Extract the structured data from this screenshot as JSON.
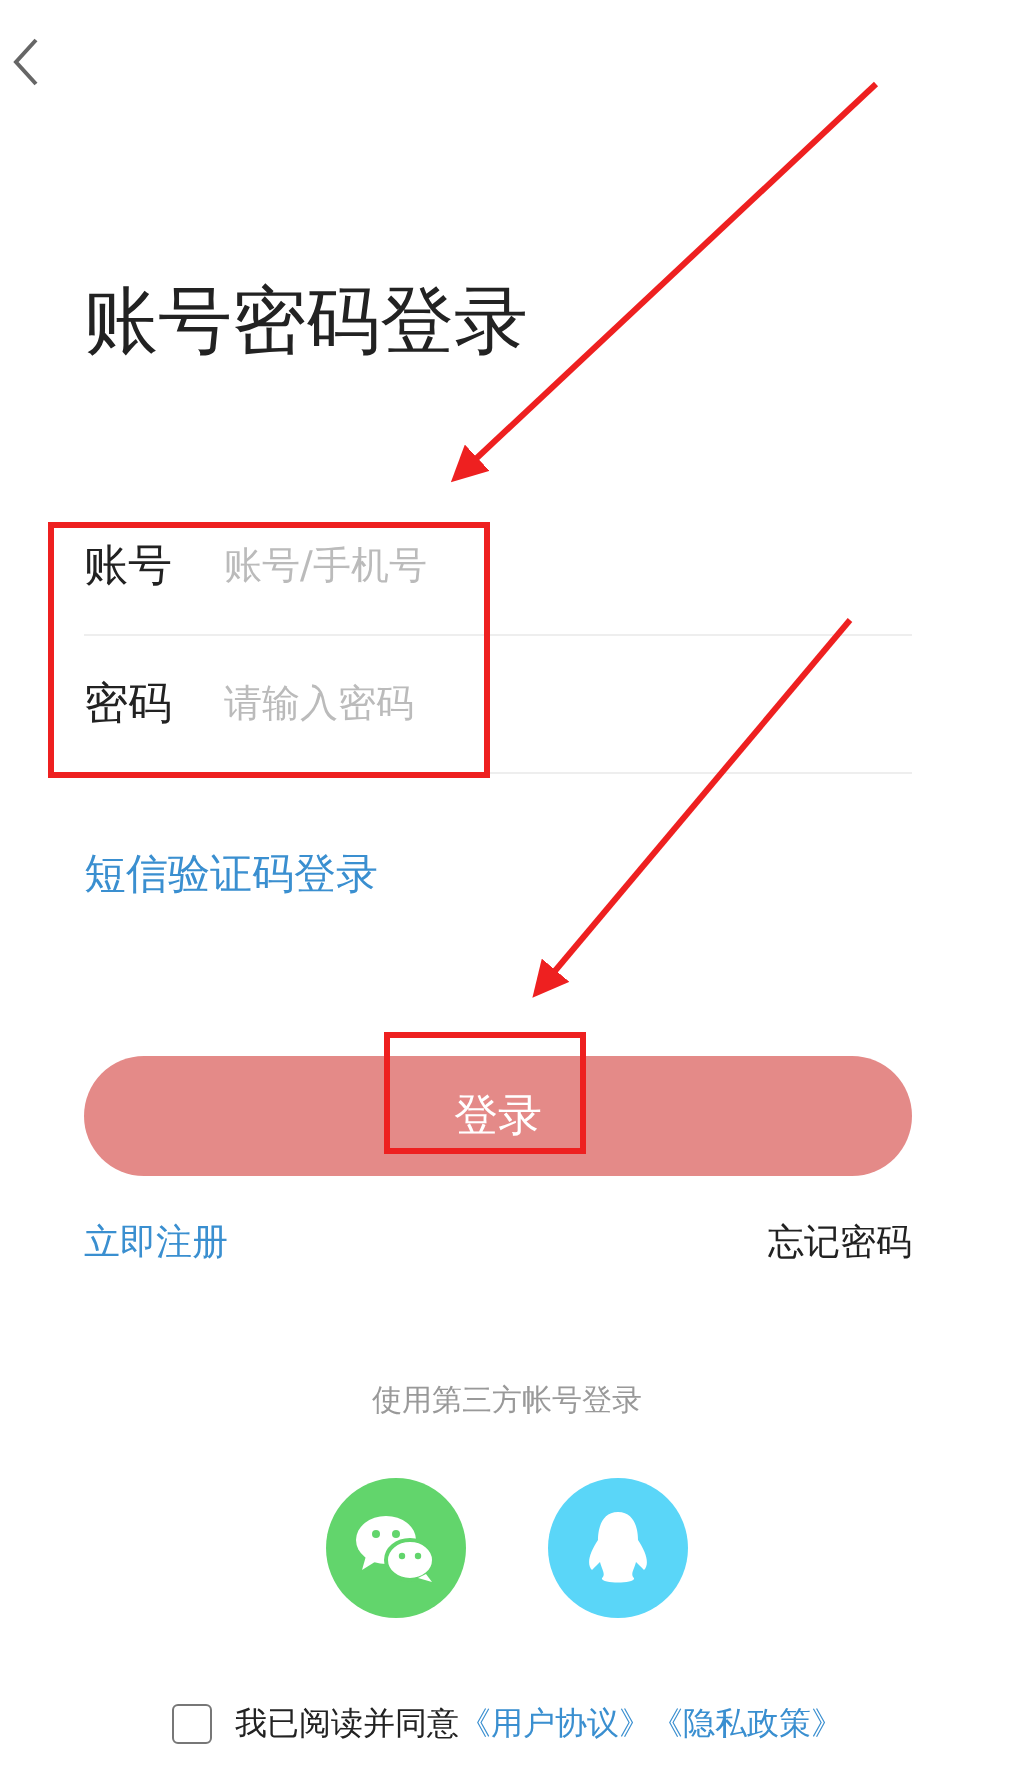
{
  "title": "账号密码登录",
  "fields": [
    {
      "label": "账号",
      "placeholder": "账号/手机号"
    },
    {
      "label": "密码",
      "placeholder": "请输入密码"
    }
  ],
  "sms_login_link": "短信验证码登录",
  "login_button": "登录",
  "register_link": "立即注册",
  "forgot_password_link": "忘记密码",
  "third_party": {
    "caption": "使用第三方帐号登录",
    "providers": [
      {
        "kind": "chat",
        "color": "#62d56c"
      },
      {
        "kind": "penguin",
        "color": "#5ad6f8"
      }
    ]
  },
  "agreement": {
    "checked": false,
    "text": "我已阅读并同意",
    "links": [
      "《用户协议》",
      "《隐私政策》"
    ]
  }
}
